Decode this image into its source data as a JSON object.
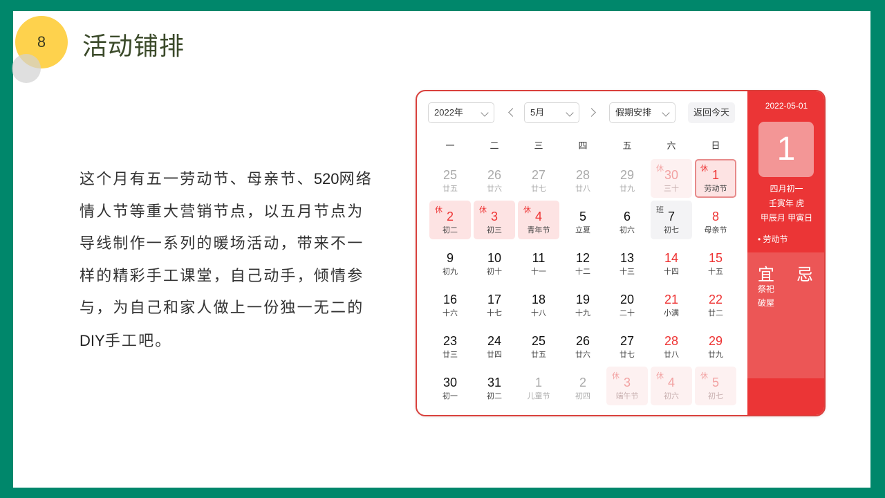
{
  "slide": {
    "number": "8",
    "title": "活动铺排",
    "paragraph_parts": [
      "这个月有五一劳动节、母亲节、",
      "520",
      "网络情人节等重大营销节点，以五月节点为导线制作一系列的暖场活动，带来不一样的精彩手工课堂，自己动手，倾情参与，为自己和家人做上一份独一无二的",
      "DIY",
      "手工吧。"
    ]
  },
  "calendar": {
    "year_select": "2022年",
    "month_select": "5月",
    "holiday_select": "假期安排",
    "today_button": "返回今天",
    "weekdays": [
      "一",
      "二",
      "三",
      "四",
      "五",
      "六",
      "日"
    ],
    "days": [
      {
        "n": "25",
        "sub": "廿五",
        "type": "other"
      },
      {
        "n": "26",
        "sub": "廿六",
        "type": "other"
      },
      {
        "n": "27",
        "sub": "廿七",
        "type": "other"
      },
      {
        "n": "28",
        "sub": "廿八",
        "type": "other"
      },
      {
        "n": "29",
        "sub": "廿九",
        "type": "other"
      },
      {
        "n": "30",
        "sub": "三十",
        "type": "other rest",
        "tag": "休"
      },
      {
        "n": "1",
        "sub": "劳动节",
        "type": "rest selected",
        "tag": "休"
      },
      {
        "n": "2",
        "sub": "初二",
        "type": "rest",
        "tag": "休"
      },
      {
        "n": "3",
        "sub": "初三",
        "type": "rest",
        "tag": "休"
      },
      {
        "n": "4",
        "sub": "青年节",
        "type": "rest",
        "tag": "休"
      },
      {
        "n": "5",
        "sub": "立夏",
        "type": ""
      },
      {
        "n": "6",
        "sub": "初六",
        "type": ""
      },
      {
        "n": "7",
        "sub": "初七",
        "type": "work",
        "tag": "班"
      },
      {
        "n": "8",
        "sub": "母亲节",
        "type": "weekend"
      },
      {
        "n": "9",
        "sub": "初九",
        "type": ""
      },
      {
        "n": "10",
        "sub": "初十",
        "type": ""
      },
      {
        "n": "11",
        "sub": "十一",
        "type": ""
      },
      {
        "n": "12",
        "sub": "十二",
        "type": ""
      },
      {
        "n": "13",
        "sub": "十三",
        "type": ""
      },
      {
        "n": "14",
        "sub": "十四",
        "type": "weekend"
      },
      {
        "n": "15",
        "sub": "十五",
        "type": "weekend"
      },
      {
        "n": "16",
        "sub": "十六",
        "type": ""
      },
      {
        "n": "17",
        "sub": "十七",
        "type": ""
      },
      {
        "n": "18",
        "sub": "十八",
        "type": ""
      },
      {
        "n": "19",
        "sub": "十九",
        "type": ""
      },
      {
        "n": "20",
        "sub": "二十",
        "type": ""
      },
      {
        "n": "21",
        "sub": "小满",
        "type": "weekend"
      },
      {
        "n": "22",
        "sub": "廿二",
        "type": "weekend"
      },
      {
        "n": "23",
        "sub": "廿三",
        "type": ""
      },
      {
        "n": "24",
        "sub": "廿四",
        "type": ""
      },
      {
        "n": "25",
        "sub": "廿五",
        "type": ""
      },
      {
        "n": "26",
        "sub": "廿六",
        "type": ""
      },
      {
        "n": "27",
        "sub": "廿七",
        "type": ""
      },
      {
        "n": "28",
        "sub": "廿八",
        "type": "weekend"
      },
      {
        "n": "29",
        "sub": "廿九",
        "type": "weekend"
      },
      {
        "n": "30",
        "sub": "初一",
        "type": ""
      },
      {
        "n": "31",
        "sub": "初二",
        "type": ""
      },
      {
        "n": "1",
        "sub": "儿童节",
        "type": "other"
      },
      {
        "n": "2",
        "sub": "初四",
        "type": "other"
      },
      {
        "n": "3",
        "sub": "端午节",
        "type": "other rest",
        "tag": "休"
      },
      {
        "n": "4",
        "sub": "初六",
        "type": "other rest",
        "tag": "休"
      },
      {
        "n": "5",
        "sub": "初七",
        "type": "other rest",
        "tag": "休"
      }
    ],
    "side": {
      "date": "2022-05-01",
      "day": "1",
      "lunar": "四月初一",
      "year_ganzhi": "壬寅年 虎",
      "month_day_ganzhi": "甲辰月 甲寅日",
      "festival": "• 劳动节",
      "yi_label": "宜",
      "ji_label": "忌",
      "yi_items": [
        "祭祀",
        "破屋"
      ]
    }
  }
}
